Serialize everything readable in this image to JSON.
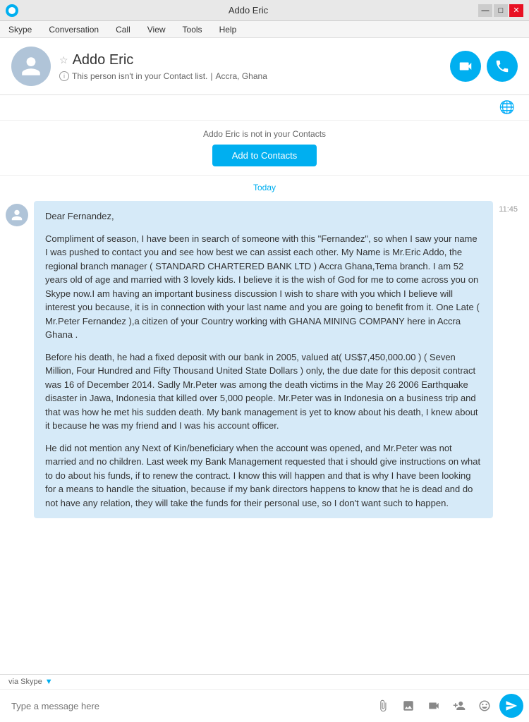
{
  "window": {
    "title": "Addo Eric",
    "controls": {
      "minimize": "—",
      "maximize": "□",
      "close": "✕"
    }
  },
  "menu": {
    "items": [
      "Skype",
      "Conversation",
      "Call",
      "View",
      "Tools",
      "Help"
    ]
  },
  "profile": {
    "name": "Addo Eric",
    "subtitle": "This person isn't in your Contact list.",
    "location": "Accra, Ghana",
    "not_in_contacts_text": "Addo Eric is not in your Contacts",
    "add_button_label": "Add to Contacts"
  },
  "chat": {
    "date_separator": "Today",
    "message_time": "11:45",
    "message_paragraphs": [
      "Dear Fernandez,",
      "Compliment of season, I have been in search of someone with this \"Fernandez\", so when I saw your name I was pushed to contact you and see how best we can assist each other. My Name is Mr.Eric Addo, the regional branch manager ( STANDARD CHARTERED BANK LTD ) Accra Ghana,Tema branch. I am 52 years old of age and married with 3 lovely kids. I believe it is the wish of God for me to come across you on Skype now.I am having an important business discussion I wish to share with you which I believe will interest you because, it is in connection with your last name and you are going to benefit from it. One Late ( Mr.Peter Fernandez ),a citizen of your Country working with GHANA MINING COMPANY here in Accra Ghana .",
      "Before his death, he had a fixed deposit with our bank in 2005, valued at( US$7,450,000.00 ) ( Seven Million, Four Hundred and Fifty Thousand United State Dollars ) only, the due date for this deposit contract was 16 of December 2014. Sadly Mr.Peter was among the death victims in the May 26 2006 Earthquake disaster in Jawa, Indonesia that killed over 5,000 people. Mr.Peter was in Indonesia on a business trip and that was how he met his sudden death. My bank management is yet to know about his death, I knew about it because he was my friend and I was his account officer.",
      "He did not mention any Next of Kin/beneficiary when the account was opened, and Mr.Peter was not married and no children. Last week my Bank Management requested that i should give instructions on what to do about his funds, if to renew the contract. I know this will happen and that is why I have been looking for a means to handle the situation, because if my bank directors happens to know that he is dead and do not have any relation, they will take the funds for their personal use, so I don't want such to happen."
    ]
  },
  "input": {
    "via_label": "via Skype",
    "placeholder": "Type a message here"
  },
  "icons": {
    "video_icon": "video-camera",
    "call_icon": "phone",
    "send_icon": "send",
    "emoji_icon": "😊",
    "attachment_icon": "📎",
    "image_icon": "🖼",
    "video_msg_icon": "📹",
    "contact_icon": "👤"
  }
}
